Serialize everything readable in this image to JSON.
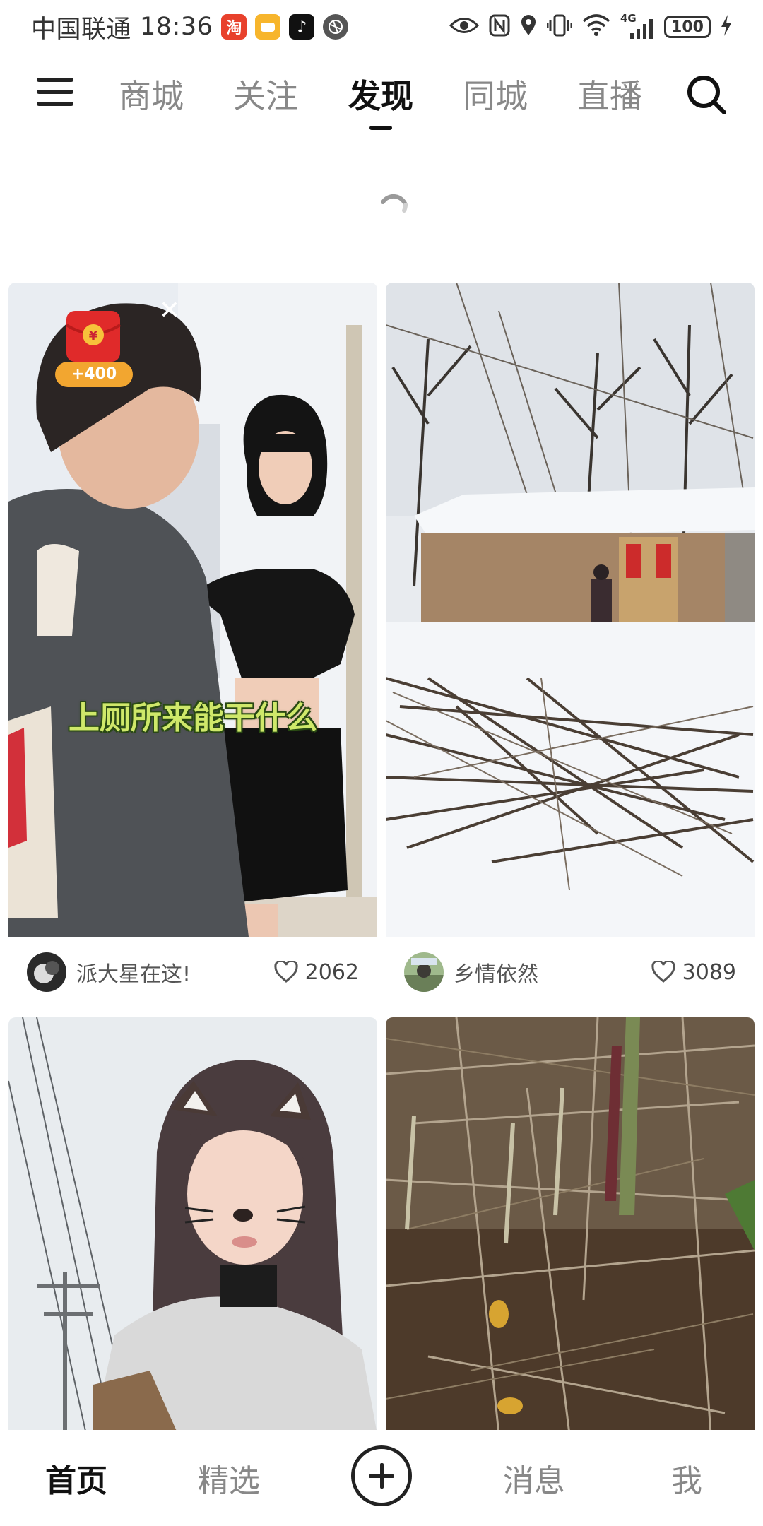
{
  "status_bar": {
    "carrier": "中国联通",
    "time": "18:36",
    "notifications": [
      {
        "name": "taobao-icon",
        "glyph": "淘",
        "color": "#e8412c"
      },
      {
        "name": "miniapp-icon",
        "glyph": "",
        "color": "#f7b52c"
      },
      {
        "name": "douyin-icon",
        "glyph": "♪",
        "color": "#111111"
      },
      {
        "name": "browser-icon",
        "glyph": "",
        "color": "#555555"
      }
    ],
    "signal": "4G",
    "battery": "100"
  },
  "top_nav": {
    "tabs": [
      {
        "label": "商城"
      },
      {
        "label": "关注"
      },
      {
        "label": "发现",
        "active": true
      },
      {
        "label": "同城"
      },
      {
        "label": "直播"
      }
    ]
  },
  "feed": {
    "cards": [
      {
        "author": "派大星在这!",
        "likes": "2062",
        "caption": "上厕所来能干什么",
        "red_packet": {
          "amount": "+400"
        }
      },
      {
        "author": "乡情依然",
        "likes": "3089"
      },
      {},
      {}
    ]
  },
  "bottom_nav": {
    "items": [
      {
        "label": "首页",
        "active": true
      },
      {
        "label": "精选"
      },
      {
        "label": "消息"
      },
      {
        "label": "我"
      }
    ]
  },
  "colors": {
    "active_text": "#111111",
    "inactive_text": "#888888",
    "red_packet": "#e02a2a",
    "caption_text": "#cfe86a"
  }
}
